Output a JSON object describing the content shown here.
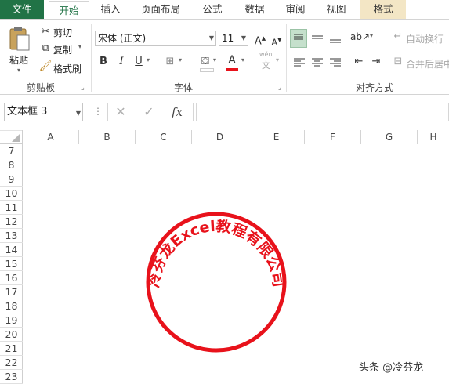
{
  "tabs": [
    {
      "label": "文件",
      "kind": "file"
    },
    {
      "label": "开始",
      "kind": "active"
    },
    {
      "label": "插入",
      "kind": "normal"
    },
    {
      "label": "页面布局",
      "kind": "normal"
    },
    {
      "label": "公式",
      "kind": "normal"
    },
    {
      "label": "数据",
      "kind": "normal"
    },
    {
      "label": "审阅",
      "kind": "normal"
    },
    {
      "label": "视图",
      "kind": "normal"
    },
    {
      "label": "格式",
      "kind": "format"
    }
  ],
  "clipboard": {
    "paste_label": "粘贴",
    "cut_label": "剪切",
    "copy_label": "复制",
    "format_painter_label": "格式刷",
    "group_label": "剪贴板"
  },
  "font": {
    "font_name": "宋体 (正文)",
    "font_size": "11",
    "bold": "B",
    "italic": "I",
    "underline": "U",
    "font_color_glyph": "A",
    "group_label": "字体",
    "wen_label": "wén",
    "wen_char": "文"
  },
  "alignment": {
    "wrap_label": "自动换行",
    "merge_label": "合并后居中",
    "group_label": "对齐方式"
  },
  "formula_bar": {
    "name_box": "文本框 3",
    "fx": "fx",
    "formula_value": ""
  },
  "columns": [
    "A",
    "B",
    "C",
    "D",
    "E",
    "F",
    "G",
    "H"
  ],
  "rows": [
    "7",
    "8",
    "9",
    "10",
    "11",
    "12",
    "13",
    "14",
    "15",
    "16",
    "17",
    "18",
    "19",
    "20",
    "21",
    "22",
    "23"
  ],
  "seal": {
    "text": "冷芬龙Excel教程有限公司",
    "color": "#e8121b"
  },
  "watermark": "头条 @冷芬龙",
  "colors": {
    "accent": "#217346",
    "format_tab": "#f3e6c5",
    "seal": "#e8121b"
  }
}
